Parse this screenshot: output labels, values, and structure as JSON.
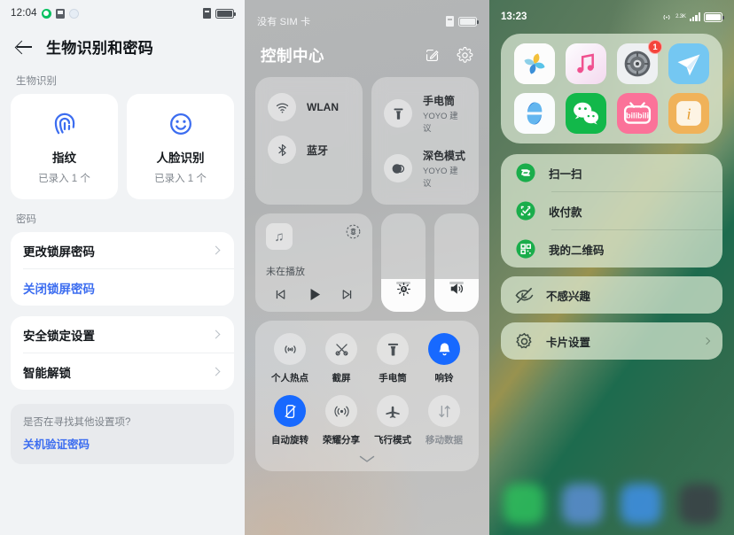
{
  "settings_panel": {
    "status_bar": {
      "time": "12:04",
      "icons": [
        "wechat-icon",
        "notification-icon",
        "weather-icon"
      ],
      "right_icons": [
        "sim-card-icon",
        "battery-icon"
      ]
    },
    "title": "生物识别和密码",
    "back_label": "back-arrow",
    "section_biometric_label": "生物识别",
    "biometric_cards": [
      {
        "icon": "fingerprint-icon",
        "name": "指纹",
        "sub": "已录入 1 个"
      },
      {
        "icon": "face-smile-icon",
        "name": "人脸识别",
        "sub": "已录入 1 个"
      }
    ],
    "section_password_label": "密码",
    "password_rows": [
      {
        "label": "更改锁屏密码",
        "chevron": true,
        "link": false
      },
      {
        "label": "关闭锁屏密码",
        "chevron": false,
        "link": true
      }
    ],
    "lock_rows": [
      {
        "label": "安全锁定设置",
        "chevron": true,
        "link": false
      },
      {
        "label": "智能解锁",
        "chevron": true,
        "link": false
      }
    ],
    "hint": {
      "question": "是否在寻找其他设置项?",
      "link": "关机验证密码"
    },
    "accent_color": "#3c6df0"
  },
  "control_center": {
    "status_bar": {
      "sim_text": "没有 SIM 卡",
      "right_icons": [
        "sim-card-icon",
        "battery-icon"
      ]
    },
    "title": "控制中心",
    "header_icons": [
      "edit-icon",
      "settings-gear-icon"
    ],
    "connectivity_tiles": [
      {
        "icon": "wifi-icon",
        "title": "WLAN",
        "sub": ""
      },
      {
        "icon": "bluetooth-icon",
        "title": "蓝牙",
        "sub": ""
      },
      {
        "icon": "flashlight-icon",
        "title": "手电筒",
        "sub": "YOYO 建议"
      },
      {
        "icon": "dark-mode-icon",
        "title": "深色模式",
        "sub": "YOYO 建议"
      }
    ],
    "player": {
      "album_icon": "music-note-icon",
      "cast_icon": "cast-icon",
      "status": "未在播放",
      "controls": [
        "previous-track-icon",
        "play-icon",
        "next-track-icon"
      ]
    },
    "sliders": [
      {
        "name": "brightness-slider",
        "icon": "brightness-auto-icon",
        "value_pct": 33
      },
      {
        "name": "volume-slider",
        "icon": "volume-icon",
        "value_pct": 33
      }
    ],
    "toggles": [
      {
        "label": "个人热点",
        "icon": "hotspot-icon",
        "on": false,
        "dim": false
      },
      {
        "label": "截屏",
        "icon": "screenshot-icon",
        "on": false,
        "dim": false
      },
      {
        "label": "手电筒",
        "icon": "flashlight-icon",
        "on": false,
        "dim": false
      },
      {
        "label": "响铃",
        "icon": "bell-icon",
        "on": true,
        "dim": false
      },
      {
        "label": "自动旋转",
        "icon": "rotate-lock-icon",
        "on": true,
        "dim": false
      },
      {
        "label": "荣耀分享",
        "icon": "honor-share-icon",
        "on": false,
        "dim": false
      },
      {
        "label": "飞行模式",
        "icon": "airplane-icon",
        "on": false,
        "dim": false
      },
      {
        "label": "移动数据",
        "icon": "mobile-data-icon",
        "on": false,
        "dim": true
      }
    ],
    "expand_handle": "chevron-down-icon",
    "accent_color": "#1769ff"
  },
  "home_screen": {
    "status_bar": {
      "time": "13:23",
      "network_label": "2.3K",
      "icons": [
        "hotspot-icon",
        "signal-bars-icon",
        "battery-icon"
      ]
    },
    "folder_apps": [
      {
        "name": "gallery-app-icon",
        "badge": ""
      },
      {
        "name": "music-app-icon",
        "badge": ""
      },
      {
        "name": "settings-app-icon",
        "badge": "1"
      },
      {
        "name": "messaging-app-icon",
        "badge": ""
      },
      {
        "name": "browser-app-icon",
        "badge": ""
      },
      {
        "name": "wechat-app-icon",
        "badge": ""
      },
      {
        "name": "bilibili-app-icon",
        "badge": ""
      },
      {
        "name": "notes-app-icon",
        "badge": ""
      }
    ],
    "shortcut_menu": [
      {
        "label": "扫一扫",
        "icon": "scan-icon"
      },
      {
        "label": "收付款",
        "icon": "payment-icon"
      },
      {
        "label": "我的二维码",
        "icon": "qr-code-icon"
      }
    ],
    "not_interested": {
      "label": "不感兴趣",
      "icon": "eye-off-icon"
    },
    "card_settings": {
      "label": "卡片设置",
      "icon": "gear-icon",
      "chevron": true
    },
    "dock_colors": [
      "#2fbf5c",
      "#5b8ed4",
      "#3f90e8",
      "#3a3f46"
    ]
  }
}
